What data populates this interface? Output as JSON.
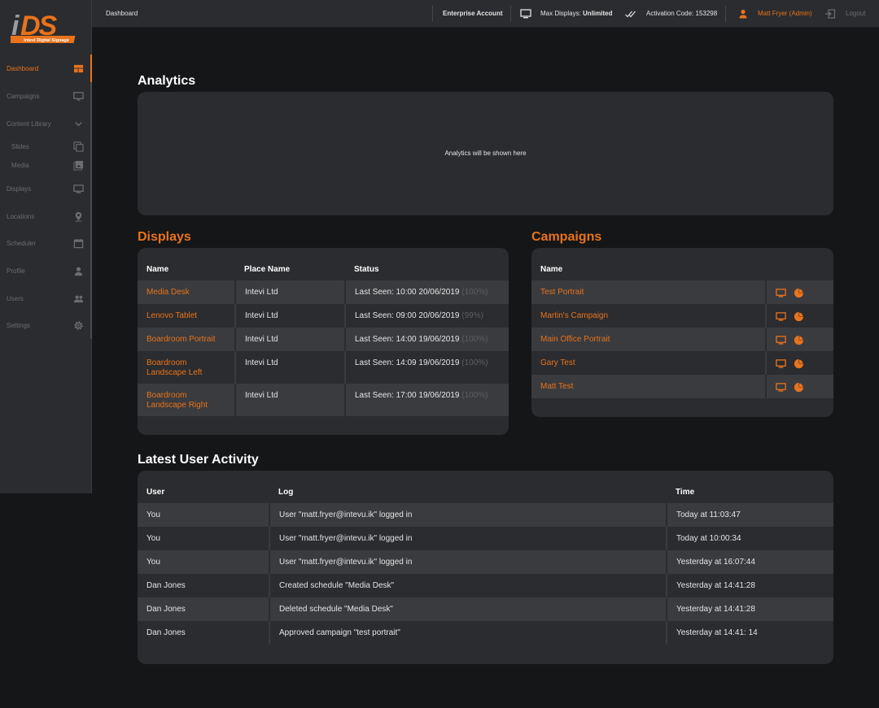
{
  "app": {
    "logo_text": "iDS",
    "logo_sub": "Intevi Digital Signage",
    "accent_color": "#e8731c"
  },
  "topbar": {
    "breadcrumb": "Dashboard",
    "account": "Enterprise Account",
    "max_displays_label": "Max Displays:",
    "max_displays_value": "Unlimited",
    "activation_label": "Activation Code:",
    "activation_code": "153298",
    "user": "Matt Fryer (Admin)",
    "logout": "Logout"
  },
  "sidebar": {
    "items": [
      {
        "label": "Dashboard",
        "icon": "dashboard-icon"
      },
      {
        "label": "Campaigns",
        "icon": "monitor-icon"
      },
      {
        "label": "Content Library",
        "icon": "chevron-down-icon"
      },
      {
        "label": "Slides",
        "icon": "slides-icon"
      },
      {
        "label": "Media",
        "icon": "media-icon"
      },
      {
        "label": "Displays",
        "icon": "display-icon"
      },
      {
        "label": "Locations",
        "icon": "location-pin-icon"
      },
      {
        "label": "Scheduler",
        "icon": "calendar-icon"
      },
      {
        "label": "Profile",
        "icon": "person-icon"
      },
      {
        "label": "Users",
        "icon": "users-icon"
      },
      {
        "label": "Settings",
        "icon": "gear-icon"
      }
    ]
  },
  "analytics": {
    "title": "Analytics",
    "placeholder": "Analytics will be shown here"
  },
  "displays": {
    "title": "Displays",
    "columns": [
      "Name",
      "Place Name",
      "Status"
    ],
    "rows": [
      {
        "name": "Media Desk",
        "place": "Intevi Ltd",
        "status": "Last Seen: 10:00 20/06/2019",
        "pct": "(100%)"
      },
      {
        "name": "Lenovo Tablet",
        "place": "Intevi Ltd",
        "status": "Last Seen: 09:00 20/06/2019",
        "pct": "(99%)"
      },
      {
        "name": "Boardroom Portrait",
        "place": "Intevi Ltd",
        "status": "Last Seen: 14:00 19/06/2019",
        "pct": "(100%)"
      },
      {
        "name": "Boardroom Landscape Left",
        "place": "Intevi Ltd",
        "status": "Last Seen: 14:09 19/06/2019",
        "pct": "(100%)"
      },
      {
        "name": "Boardroom Landscape Right",
        "place": "Intevi Ltd",
        "status": "Last Seen: 17:00 19/06/2019",
        "pct": "(100%)"
      }
    ]
  },
  "campaigns": {
    "title": "Campaigns",
    "columns": [
      "Name"
    ],
    "rows": [
      {
        "name": "Test Portrait"
      },
      {
        "name": "Martin's Campaign"
      },
      {
        "name": "Main Office Portrait"
      },
      {
        "name": "Gary Test"
      },
      {
        "name": "Matt Test"
      }
    ]
  },
  "activity": {
    "title": "Latest User Activity",
    "columns": [
      "User",
      "Log",
      "Time"
    ],
    "rows": [
      {
        "user": "You",
        "log": "User \"matt.fryer@intevu.ik\" logged in",
        "time": "Today at 11:03:47"
      },
      {
        "user": "You",
        "log": "User \"matt.fryer@intevu.ik\" logged in",
        "time": "Today at 10:00:34"
      },
      {
        "user": "You",
        "log": "User \"matt.fryer@intevu.ik\" logged in",
        "time": "Yesterday at 16:07:44"
      },
      {
        "user": "Dan Jones",
        "log": "Created schedule \"Media Desk\"",
        "time": "Yesterday at 14:41:28"
      },
      {
        "user": "Dan Jones",
        "log": "Deleted schedule \"Media Desk\"",
        "time": "Yesterday at 14:41:28"
      },
      {
        "user": "Dan Jones",
        "log": "Approved campaign \"test portrait\"",
        "time": "Yesterday at 14:41: 14"
      }
    ]
  }
}
